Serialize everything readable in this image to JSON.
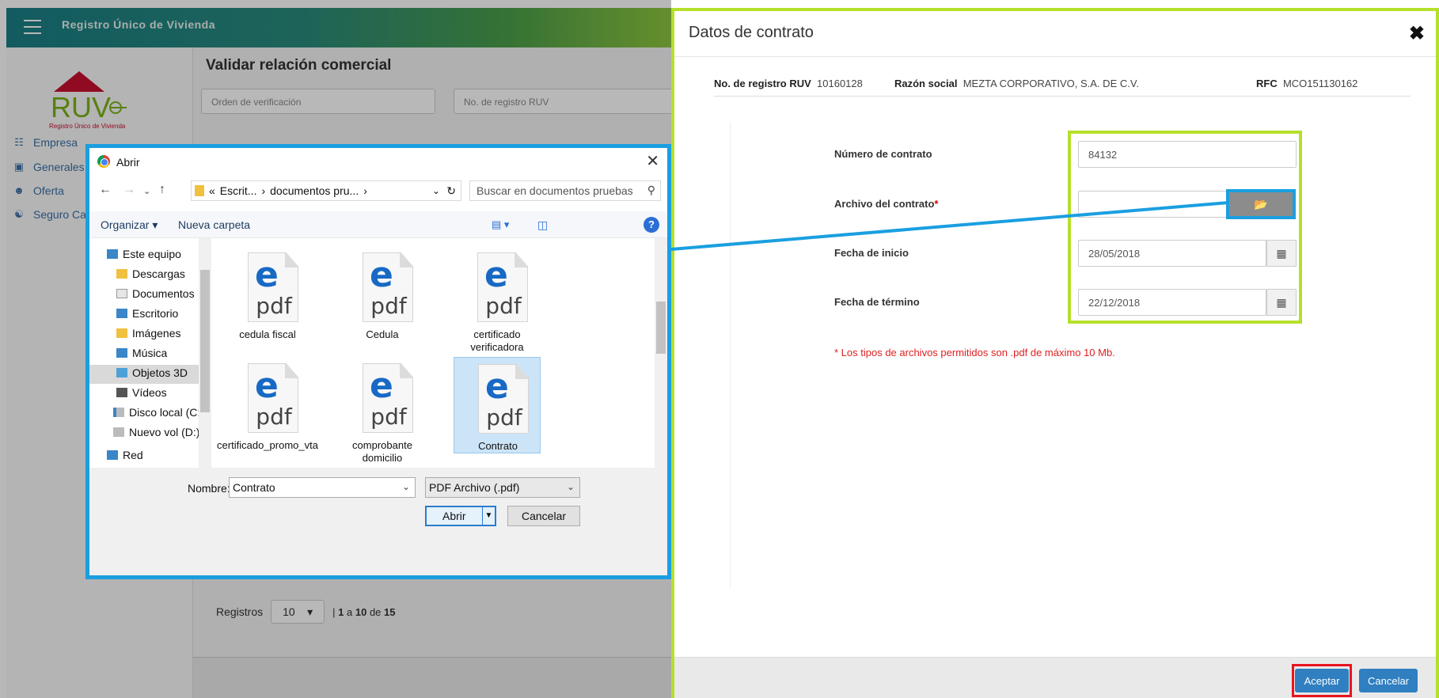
{
  "app": {
    "title": "Registro Único de Vivienda",
    "logo_text": "RUV",
    "logo_subtitle": "Registro Único de Vivienda"
  },
  "sidebar": {
    "items": [
      {
        "label": "Empresa"
      },
      {
        "label": "Generales"
      },
      {
        "label": "Oferta"
      },
      {
        "label": "Seguro Ca"
      }
    ]
  },
  "main": {
    "title": "Validar relación comercial",
    "filter_orden_placeholder": "Orden de verificación",
    "filter_ruv_placeholder": "No. de registro RUV",
    "registros_label": "Registros",
    "registros_value": "10",
    "pagination": {
      "from": "1",
      "sep": "a",
      "to": "10",
      "of_label": "de",
      "total": "15"
    }
  },
  "modal": {
    "title": "Datos de contrato",
    "close_icon": "close-icon",
    "info": {
      "ruv_label": "No. de registro RUV",
      "ruv_value": "10160128",
      "razon_label": "Razón social",
      "razon_value": "MEZTA CORPORATIVO, S.A. DE C.V.",
      "rfc_label": "RFC",
      "rfc_value": "MCO151130162"
    },
    "form": {
      "numero_label": "Número de contrato",
      "numero_value": "84132",
      "archivo_label": "Archivo del contrato",
      "archivo_required": "*",
      "archivo_value": "",
      "inicio_label": "Fecha de inicio",
      "inicio_value": "28/05/2018",
      "termino_label": "Fecha de término",
      "termino_value": "22/12/2018"
    },
    "note": "* Los tipos de archivos permitidos son .pdf de máximo 10 Mb.",
    "accept_label": "Aceptar",
    "cancel_label": "Cancelar"
  },
  "dialog": {
    "title": "Abrir",
    "address_parts": [
      "«",
      "Escrit...",
      "›",
      "documentos pru...",
      "›"
    ],
    "search_placeholder": "Buscar en documentos pruebas",
    "organize_label": "Organizar ▾",
    "new_folder_label": "Nueva carpeta",
    "tree": [
      {
        "label": "Este equipo"
      },
      {
        "label": "Descargas"
      },
      {
        "label": "Documentos"
      },
      {
        "label": "Escritorio"
      },
      {
        "label": "Imágenes"
      },
      {
        "label": "Música"
      },
      {
        "label": "Objetos 3D"
      },
      {
        "label": "Vídeos"
      },
      {
        "label": "Disco local (C:)"
      },
      {
        "label": "Nuevo vol (D:)"
      },
      {
        "label": "Red"
      }
    ],
    "selected_tree_item": "Escritorio",
    "files": [
      {
        "name": "cedula fiscal",
        "icon_text": "pdf"
      },
      {
        "name": "Cedula",
        "icon_text": "pdf"
      },
      {
        "name": "certificado verificadora",
        "icon_text": "pdf"
      },
      {
        "name": "certificado_promo_vta",
        "icon_text": "pdf"
      },
      {
        "name": "comprobante domicilio",
        "icon_text": "pdf"
      },
      {
        "name": "Contrato",
        "icon_text": "pdf"
      }
    ],
    "selected_file": "Contrato",
    "filename_label": "Nombre:",
    "filename_value": "Contrato",
    "filetype_value": "PDF Archivo (.pdf)",
    "open_label": "Abrir",
    "cancel_label": "Cancelar"
  },
  "colors": {
    "highlight_green": "#b5e02a",
    "highlight_blue": "#1a9fe0",
    "highlight_red": "#e8141e",
    "primary_button": "#2f7fc1"
  }
}
